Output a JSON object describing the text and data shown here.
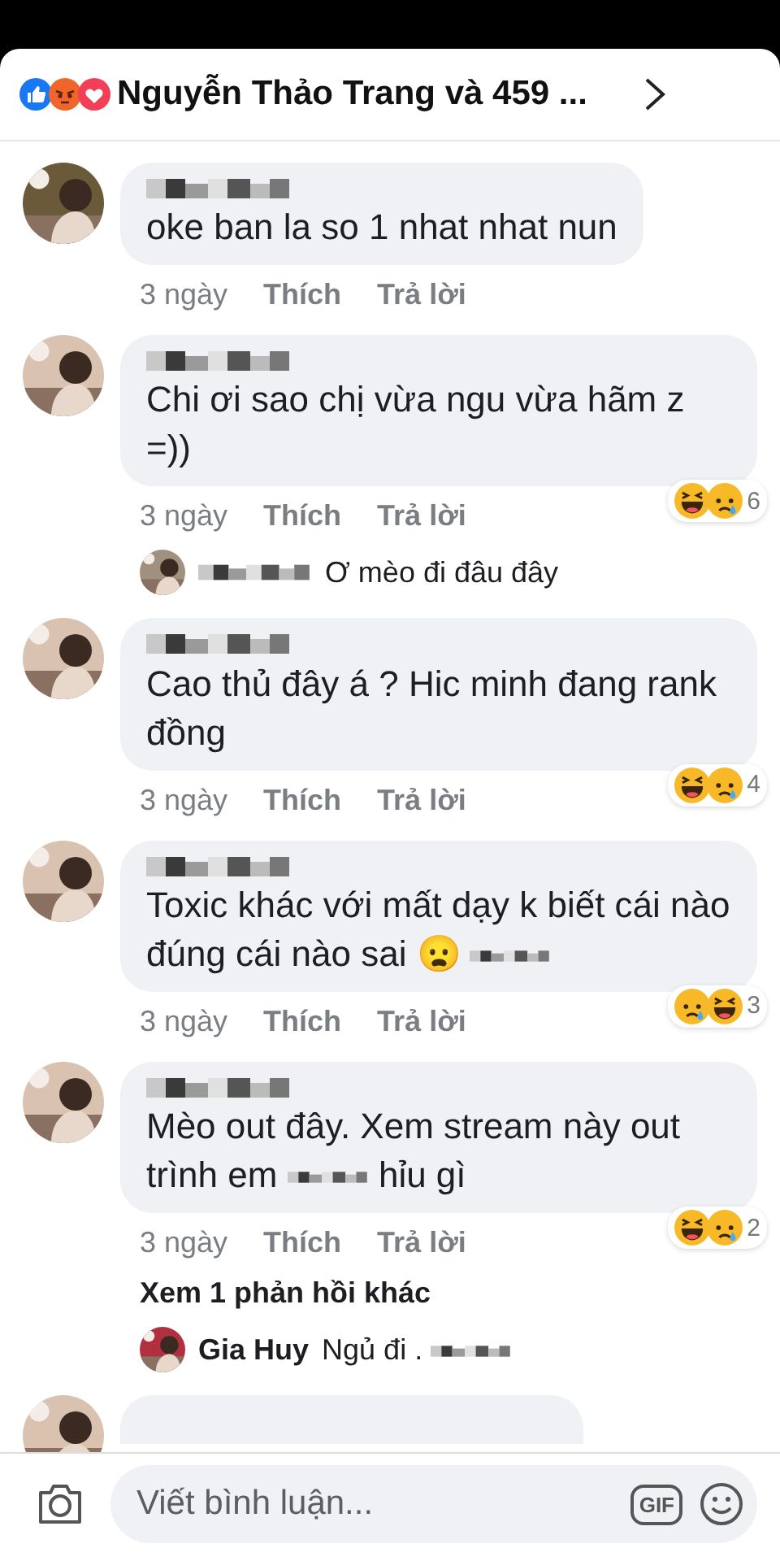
{
  "header": {
    "reactions": [
      {
        "kind": "like"
      },
      {
        "kind": "angry"
      },
      {
        "kind": "love"
      }
    ],
    "title": "Nguyễn Thảo Trang và 459 ..."
  },
  "comments": [
    {
      "name_redacted": true,
      "segments": [
        {
          "kind": "text",
          "text": "oke ban la so 1 nhat nhat nun"
        }
      ],
      "time": "3 ngày",
      "like": "Thích",
      "reply": "Trả lời"
    },
    {
      "name_redacted": true,
      "segments": [
        {
          "kind": "text",
          "text": "Chi ơi sao chị vừa ngu vừa hãm z =))"
        }
      ],
      "time": "3 ngày",
      "like": "Thích",
      "reply": "Trả lời",
      "reactions": [
        {
          "kind": "haha"
        },
        {
          "kind": "sad"
        }
      ],
      "reaction_count": "6",
      "replies": [
        {
          "name_redacted": true,
          "segments": [
            {
              "kind": "text",
              "text": "Ơ mèo đi đâu đây"
            }
          ]
        }
      ]
    },
    {
      "name_redacted": true,
      "segments": [
        {
          "kind": "text",
          "text": "Cao thủ đây á ? Hic minh đang rank đồng"
        }
      ],
      "time": "3 ngày",
      "like": "Thích",
      "reply": "Trả lời",
      "reactions": [
        {
          "kind": "haha"
        },
        {
          "kind": "sad"
        }
      ],
      "reaction_count": "4"
    },
    {
      "name_redacted": true,
      "segments": [
        {
          "kind": "text",
          "text": "Toxic khác với mất dạy k biết cái nào đúng cái nào sai 😦"
        },
        {
          "kind": "redacted"
        }
      ],
      "time": "3 ngày",
      "like": "Thích",
      "reply": "Trả lời",
      "reactions": [
        {
          "kind": "sad"
        },
        {
          "kind": "haha"
        }
      ],
      "reaction_count": "3"
    },
    {
      "name_redacted": true,
      "segments": [
        {
          "kind": "text",
          "text": "Mèo out đây. Xem stream này out trình em"
        },
        {
          "kind": "redacted"
        },
        {
          "kind": "text",
          "text": "hỉu gì"
        }
      ],
      "time": "3 ngày",
      "like": "Thích",
      "reply": "Trả lời",
      "reactions": [
        {
          "kind": "haha"
        },
        {
          "kind": "sad"
        }
      ],
      "reaction_count": "2",
      "more_replies": "Xem 1 phản hồi khác",
      "replies": [
        {
          "name": "Gia Huy",
          "segments": [
            {
              "kind": "text",
              "text": "Ngủ đi ."
            },
            {
              "kind": "redacted"
            }
          ]
        }
      ]
    }
  ],
  "next_comment_cut": true,
  "composer": {
    "placeholder": "Viết bình luận...",
    "gif": "GIF"
  }
}
